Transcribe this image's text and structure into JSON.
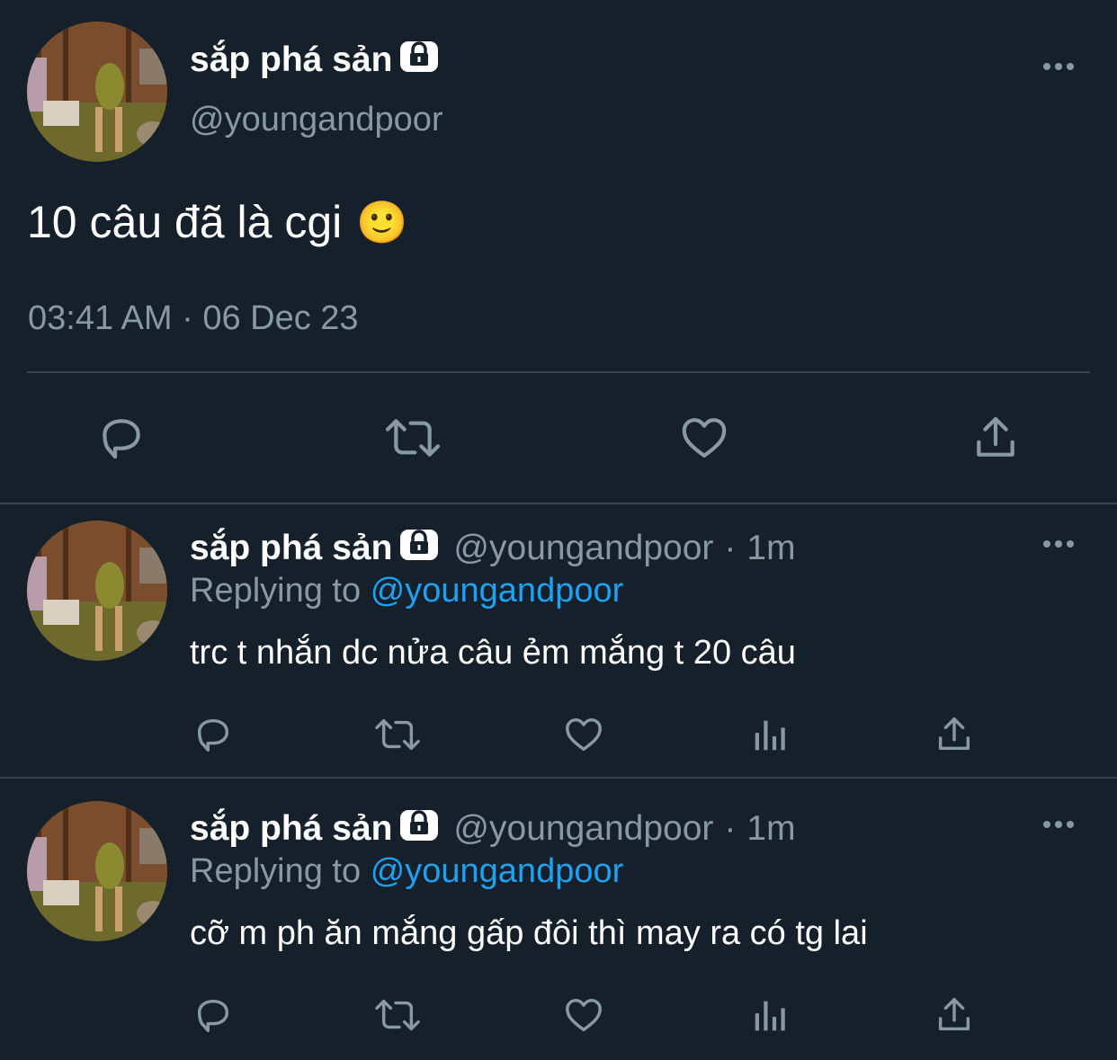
{
  "main_tweet": {
    "display_name": "sắp phá sản",
    "handle": "@youngandpoor",
    "text": "10 câu đã là cgi",
    "emoji": "🙂",
    "timestamp": "03:41 AM · 06 Dec 23",
    "lock_icon": "lock-icon",
    "actions": [
      "reply-icon",
      "retweet-icon",
      "like-icon",
      "share-icon"
    ]
  },
  "replies": [
    {
      "display_name": "sắp phá sản",
      "handle": "@youngandpoor",
      "separator": "·",
      "time": "1m",
      "replying_prefix": "Replying to",
      "replying_to": "@youngandpoor",
      "text": "trc t nhắn dc nửa câu ẻm mắng t 20 câu",
      "actions": [
        "reply-icon",
        "retweet-icon",
        "like-icon",
        "analytics-icon",
        "share-icon"
      ]
    },
    {
      "display_name": "sắp phá sản",
      "handle": "@youngandpoor",
      "separator": "·",
      "time": "1m",
      "replying_prefix": "Replying to",
      "replying_to": "@youngandpoor",
      "text": "cỡ m ph ăn mắng gấp đôi thì may ra có tg lai",
      "actions": [
        "reply-icon",
        "retweet-icon",
        "like-icon",
        "analytics-icon",
        "share-icon"
      ]
    }
  ],
  "colors": {
    "background": "#15202b",
    "text": "#ffffff",
    "secondary": "#8899a6",
    "accent": "#1da1f2",
    "divider": "#38444d"
  }
}
